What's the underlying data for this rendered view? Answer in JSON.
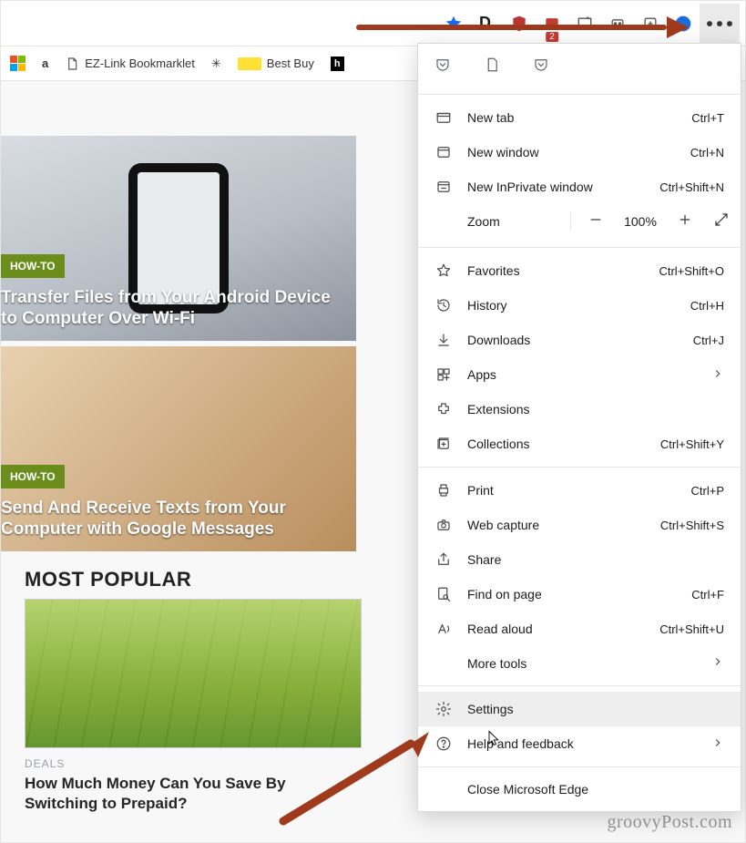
{
  "toolbar": {
    "ext_d": "D.",
    "badge_count": "2"
  },
  "bookmarks": {
    "amazon": "a",
    "ezlink": "EZ-Link Bookmarklet",
    "bestbuy": "Best Buy",
    "hulu": "h"
  },
  "article1": {
    "tag": "HOW-TO",
    "title": "Transfer Files from Your Android Device to Computer Over Wi-Fi"
  },
  "article2": {
    "tag": "HOW-TO",
    "title": "Send And Receive Texts from Your Computer with Google Messages"
  },
  "popular_heading": "MOST POPULAR",
  "popular": {
    "category": "DEALS",
    "title": "How Much Money Can You Save By Switching to Prepaid?"
  },
  "menu": {
    "new_tab": {
      "label": "New tab",
      "shortcut": "Ctrl+T"
    },
    "new_window": {
      "label": "New window",
      "shortcut": "Ctrl+N"
    },
    "new_inprivate": {
      "label": "New InPrivate window",
      "shortcut": "Ctrl+Shift+N"
    },
    "zoom": {
      "label": "Zoom",
      "value": "100%"
    },
    "favorites": {
      "label": "Favorites",
      "shortcut": "Ctrl+Shift+O"
    },
    "history": {
      "label": "History",
      "shortcut": "Ctrl+H"
    },
    "downloads": {
      "label": "Downloads",
      "shortcut": "Ctrl+J"
    },
    "apps": {
      "label": "Apps"
    },
    "extensions": {
      "label": "Extensions"
    },
    "collections": {
      "label": "Collections",
      "shortcut": "Ctrl+Shift+Y"
    },
    "print": {
      "label": "Print",
      "shortcut": "Ctrl+P"
    },
    "webcapture": {
      "label": "Web capture",
      "shortcut": "Ctrl+Shift+S"
    },
    "share": {
      "label": "Share"
    },
    "find": {
      "label": "Find on page",
      "shortcut": "Ctrl+F"
    },
    "readaloud": {
      "label": "Read aloud",
      "shortcut": "Ctrl+Shift+U"
    },
    "moretools": {
      "label": "More tools"
    },
    "settings": {
      "label": "Settings"
    },
    "help": {
      "label": "Help and feedback"
    },
    "close": {
      "label": "Close Microsoft Edge"
    }
  },
  "watermark": "groovyPost.com"
}
